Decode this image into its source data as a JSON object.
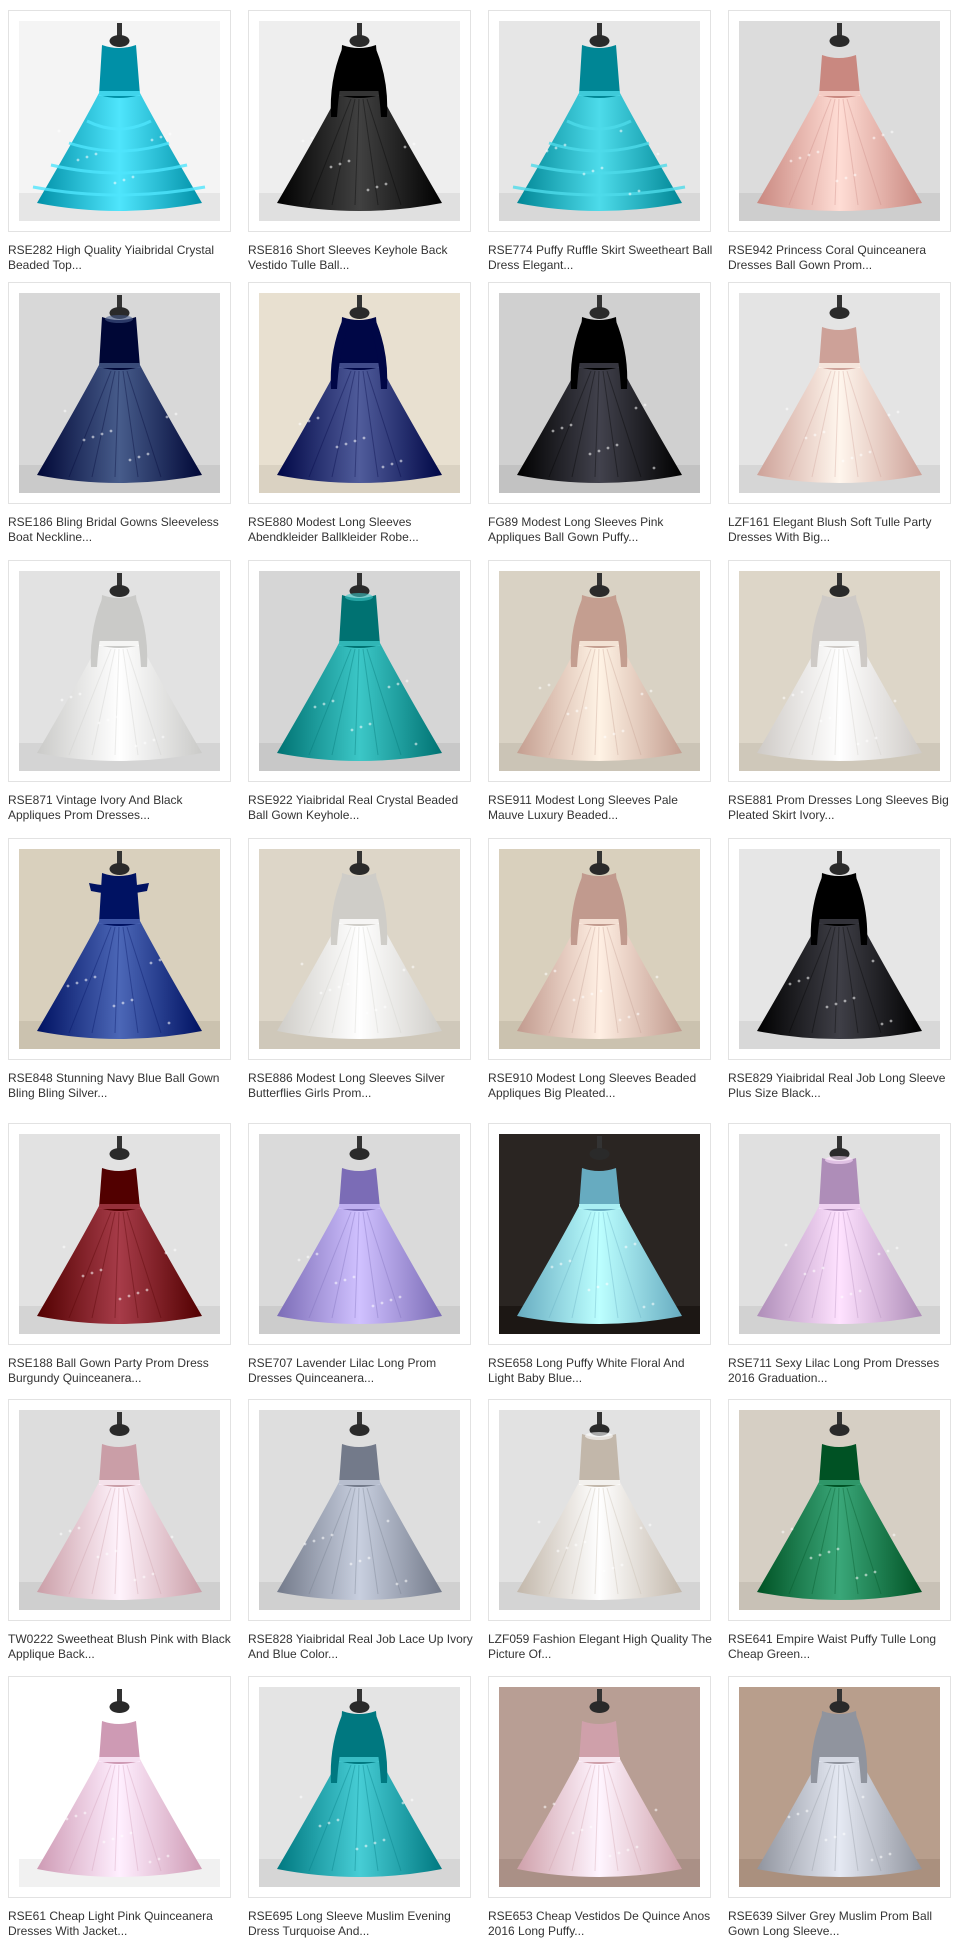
{
  "products": [
    {
      "title": "RSE282 High Quality Yiaibridal Crystal Beaded Top...",
      "color": "#22b8cf",
      "style": "ruffle",
      "bg": "#f4f4f4"
    },
    {
      "title": "RSE816 Short Sleeves Keyhole Back Vestido Tulle Ball...",
      "color": "#141414",
      "style": "sleeves",
      "bg": "#eeeeee"
    },
    {
      "title": "RSE774 Puffy Ruffle Skirt Sweetheart Ball Dress Elegant...",
      "color": "#20aebd",
      "style": "ruffle",
      "bg": "#e6e6e6"
    },
    {
      "title": "RSE942 Princess Coral Quinceanera Dresses Ball Gown Prom...",
      "color": "#f1b0a8",
      "style": "strapless",
      "bg": "#dcdcdc"
    },
    {
      "title": "RSE186 Bling Bridal Gowns Sleeveless Boat Neckline...",
      "color": "#1a2f5e",
      "style": "sleeveless",
      "bg": "#d8d8d8"
    },
    {
      "title": "RSE880 Modest Long Sleeves Abendkleider Ballkleider Robe...",
      "color": "#232f6e",
      "style": "sleeves",
      "bg": "#e8e0d0"
    },
    {
      "title": "FG89 Modest Long Sleeves Pink Appliques Ball Gown Puffy...",
      "color": "#151520",
      "style": "sleeves",
      "bg": "#d0d0d0"
    },
    {
      "title": "LZF161 Elegant Blush Soft Tulle Party Dresses With Big...",
      "color": "#f5c9c0",
      "style": "strapless",
      "bg": "#e4e4e4"
    },
    {
      "title": "RSE871 Vintage Ivory And Black Appliques Prom Dresses...",
      "color": "#f2f2f0",
      "style": "sleeves",
      "bg": "#e2e2e2"
    },
    {
      "title": "RSE922 Yiaibridal Real Crystal Beaded Ball Gown Keyhole...",
      "color": "#0f9a9a",
      "style": "sleeveless",
      "bg": "#d6d6d6"
    },
    {
      "title": "RSE911 Modest Long Sleeves Pale Mauve Luxury Beaded...",
      "color": "#ecc6b8",
      "style": "sleeves",
      "bg": "#d9d2c4"
    },
    {
      "title": "RSE881 Prom Dresses Long Sleeves Big Pleated Skirt Ivory...",
      "color": "#f6f2ee",
      "style": "sleeves",
      "bg": "#ddd6c8"
    },
    {
      "title": "RSE848 Stunning Navy Blue Ball Gown Bling Bling Silver...",
      "color": "#1f3a8a",
      "style": "offshoulder",
      "bg": "#d9d0bd"
    },
    {
      "title": "RSE886 Modest Long Sleeves Silver Butterflies Girls Prom...",
      "color": "#f7f5f0",
      "style": "sleeves",
      "bg": "#ddd6c8"
    },
    {
      "title": "RSE910 Modest Long Sleeves Beaded Appliques Big Pleated...",
      "color": "#e9c2b6",
      "style": "sleeves",
      "bg": "#d9d0bd"
    },
    {
      "title": "RSE829 Yiaibridal Real Job Long Sleeve Plus Size Black...",
      "color": "#12121a",
      "style": "sleeves",
      "bg": "#e6e6e6"
    },
    {
      "title": "RSE188 Ball Gown Party Prom Dress Burgundy Quinceanera...",
      "color": "#7a0f1c",
      "style": "strapless",
      "bg": "#e2e2e2"
    },
    {
      "title": "RSE707 Lavender Lilac Long Prom Dresses Quinceanera...",
      "color": "#a394de",
      "style": "strapless",
      "bg": "#dadada"
    },
    {
      "title": "RSE658 Long Puffy White Floral And Light Baby Blue...",
      "color": "#8fd3e8",
      "style": "strapless",
      "bg": "#2a2522"
    },
    {
      "title": "RSE711 Sexy Lilac Long Prom Dresses 2016 Graduation...",
      "color": "#d6b5e0",
      "style": "sleeveless",
      "bg": "#e0e0e0"
    },
    {
      "title": "TW0222 Sweetheat Blush Pink with Black Applique Back...",
      "color": "#f2c6cf",
      "style": "strapless",
      "bg": "#dddddd"
    },
    {
      "title": "RSE828 Yiaibridal Real Job Lace Up Ivory And Blue Color...",
      "color": "#9ba2b2",
      "style": "strapless",
      "bg": "#dedede"
    },
    {
      "title": "LZF059 Fashion Elegant High Quality The Picture Of...",
      "color": "#eadfd2",
      "style": "sleeveless",
      "bg": "#e2e2e2"
    },
    {
      "title": "RSE641 Empire Waist Puffy Tulle Long Cheap Green...",
      "color": "#0d7a4c",
      "style": "strapless",
      "bg": "#d6cfc4"
    },
    {
      "title": "RSE61 Cheap Light Pink Quinceanera Dresses With Jacket...",
      "color": "#f6c2dc",
      "style": "strapless",
      "bg": "#ffffff"
    },
    {
      "title": "RSE695 Long Sleeve Muslim Evening Dress Turquoise And...",
      "color": "#1aa0a8",
      "style": "sleeves",
      "bg": "#e4e4e4"
    },
    {
      "title": "RSE653 Cheap Vestidos De Quince Anos 2016 Long Puffy...",
      "color": "#f7c8d2",
      "style": "strapless",
      "bg": "#b89e94"
    },
    {
      "title": "RSE639 Silver Grey Muslim Prom Ball Gown Long Sleeve...",
      "color": "#b8bcc6",
      "style": "sleeves",
      "bg": "#b89e8c"
    }
  ]
}
